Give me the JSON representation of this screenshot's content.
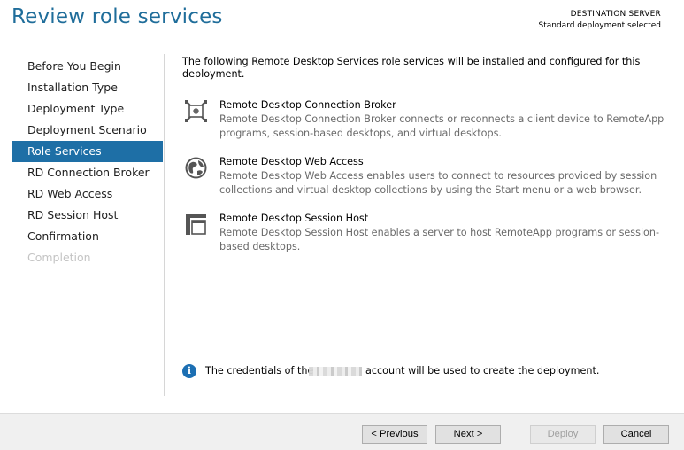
{
  "page": {
    "title": "Review role services",
    "destination_label": "DESTINATION SERVER",
    "destination_value": "Standard deployment selected"
  },
  "sidebar": {
    "items": [
      {
        "label": "Before You Begin",
        "state": "normal"
      },
      {
        "label": "Installation Type",
        "state": "normal"
      },
      {
        "label": "Deployment Type",
        "state": "normal"
      },
      {
        "label": "Deployment Scenario",
        "state": "normal"
      },
      {
        "label": "Role Services",
        "state": "active"
      },
      {
        "label": "RD Connection Broker",
        "state": "normal"
      },
      {
        "label": "RD Web Access",
        "state": "normal"
      },
      {
        "label": "RD Session Host",
        "state": "normal"
      },
      {
        "label": "Confirmation",
        "state": "normal"
      },
      {
        "label": "Completion",
        "state": "disabled"
      }
    ]
  },
  "main": {
    "intro": "The following Remote Desktop Services role services will be installed and configured for this deployment.",
    "services": [
      {
        "icon": "connection-broker-icon",
        "name": "Remote Desktop Connection Broker",
        "description": "Remote Desktop Connection Broker connects or reconnects a client device to RemoteApp programs, session-based desktops, and virtual desktops."
      },
      {
        "icon": "web-access-globe-icon",
        "name": "Remote Desktop Web Access",
        "description": "Remote Desktop Web Access enables users to connect to resources provided by session collections and virtual desktop collections by using the Start menu or a web browser."
      },
      {
        "icon": "session-host-icon",
        "name": "Remote Desktop Session Host",
        "description": "Remote Desktop Session Host enables a server to host RemoteApp programs or session-based desktops."
      }
    ],
    "note_before": "The credentials of the",
    "note_after": "account will be used to create the deployment."
  },
  "footer": {
    "previous": "< Previous",
    "next": "Next >",
    "deploy": "Deploy",
    "cancel": "Cancel"
  },
  "colors": {
    "accent": "#1e6fa6",
    "title": "#1f6d9a",
    "disabled_text": "#c4c4c4"
  }
}
